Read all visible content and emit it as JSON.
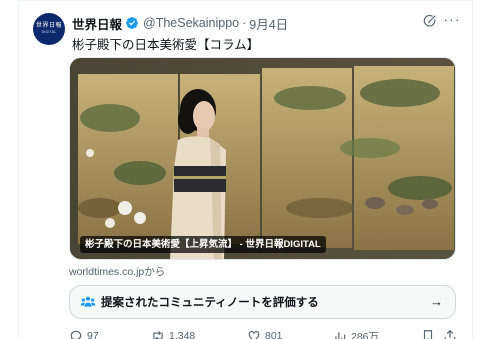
{
  "account": {
    "avatar_text_top": "世界日報",
    "avatar_text_bottom": "DIGITAL",
    "name": "世界日報",
    "handle": "@TheSekainippo",
    "separator": "·",
    "date": "9月4日"
  },
  "tweet": {
    "text": "彬子殿下の日本美術愛【コラム】",
    "media_caption": "彬子殿下の日本美術愛【上昇気流】 - 世界日報DIGITAL",
    "source": "worldtimes.co.jpから"
  },
  "community_note": {
    "label": "提案されたコミュニティノートを評価する",
    "arrow": "→"
  },
  "actions": {
    "replies": "97",
    "reposts": "1,348",
    "likes": "801",
    "views": "286万"
  },
  "more_glyph": "···",
  "colors": {
    "verified": "#1d9bf0",
    "secondary_text": "#536471",
    "note_icon": "#1d9bf0"
  }
}
